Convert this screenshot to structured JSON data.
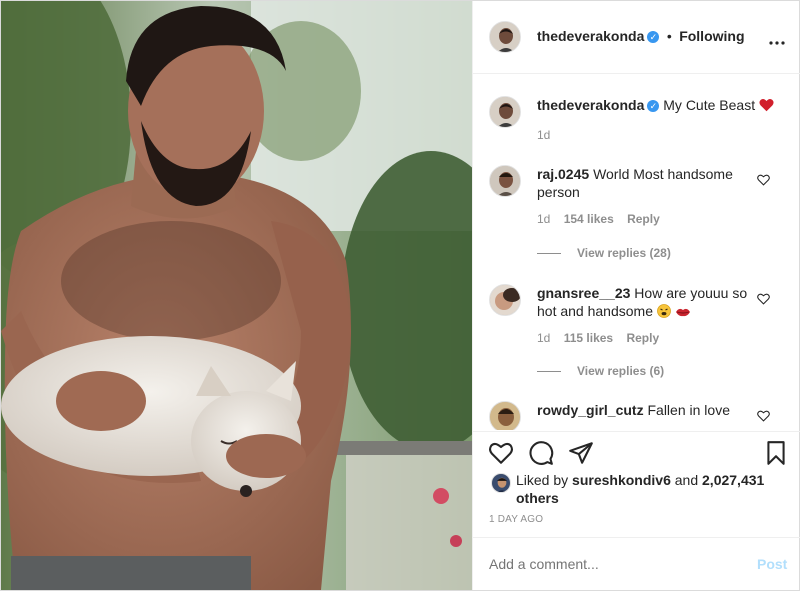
{
  "header": {
    "username": "thedeverakonda",
    "follow_separator": "•",
    "follow_status": "Following",
    "more_icon": "more-horizontal-icon"
  },
  "caption": {
    "username": "thedeverakonda",
    "text": "My Cute Beast",
    "emoji_icon": "red-heart-icon",
    "time": "1d"
  },
  "comments": [
    {
      "username": "raj.0245",
      "text": "World Most handsome person",
      "time": "1d",
      "likes": "154 likes",
      "reply_label": "Reply",
      "view_replies": "View replies (28)"
    },
    {
      "username": "gnansree__23",
      "text": "How are youuu so hot and handsome",
      "time": "1d",
      "likes": "115 likes",
      "reply_label": "Reply",
      "view_replies": "View replies (6)"
    },
    {
      "username": "rowdy_girl_cutz",
      "text": "Fallen in love"
    }
  ],
  "actions": {
    "icons": [
      "heart-icon",
      "comment-icon",
      "share-icon",
      "bookmark-icon"
    ]
  },
  "likes": {
    "prefix": "Liked by",
    "user": "sureshkondiv6",
    "conj": "and",
    "count": "2,027,431 others"
  },
  "timestamp": "1 DAY AGO",
  "add_comment": {
    "placeholder": "Add a comment...",
    "post_label": "Post"
  },
  "colors": {
    "accent_blue": "#0095f6",
    "verified_blue": "#3897f0",
    "post_disabled": "#b2dffc",
    "heart_red": "#ed4956"
  }
}
